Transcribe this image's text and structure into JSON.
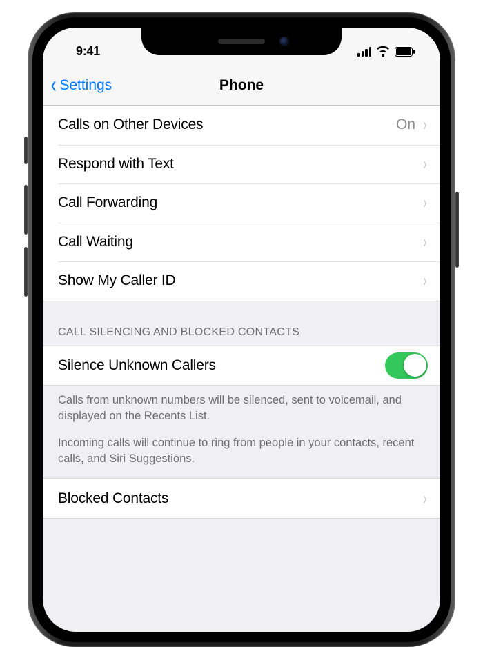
{
  "status_bar": {
    "time": "9:41"
  },
  "nav": {
    "back_label": "Settings",
    "title": "Phone"
  },
  "group1": {
    "rows": [
      {
        "label": "Calls on Other Devices",
        "value": "On"
      },
      {
        "label": "Respond with Text"
      },
      {
        "label": "Call Forwarding"
      },
      {
        "label": "Call Waiting"
      },
      {
        "label": "Show My Caller ID"
      }
    ]
  },
  "section_silencing": {
    "header": "CALL SILENCING AND BLOCKED CONTACTS",
    "toggle_row": {
      "label": "Silence Unknown Callers",
      "on": true
    },
    "footer_p1": "Calls from unknown numbers will be silenced, sent to voicemail, and displayed on the Recents List.",
    "footer_p2": "Incoming calls will continue to ring from people in your contacts, recent calls, and Siri Suggestions."
  },
  "group_blocked": {
    "label": "Blocked Contacts"
  },
  "colors": {
    "tint": "#007aff",
    "switch_on": "#34c759",
    "secondary_text": "#8e8e93"
  }
}
